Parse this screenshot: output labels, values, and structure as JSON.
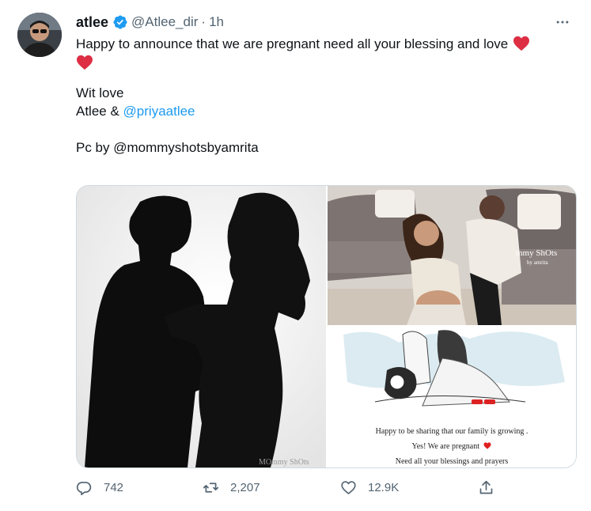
{
  "author": {
    "name": "atlee",
    "handle": "@Atlee_dir",
    "separator": "·",
    "time": "1h",
    "verified": true
  },
  "tweet": {
    "line1": "Happy to announce that we are pregnant need all your blessing and love",
    "line2": "Wit love",
    "line3_prefix": "Atlee & ",
    "line3_mention": "@priyaatlee",
    "line4": "Pc by @mommyshotsbyamrita"
  },
  "media": {
    "watermark_left": "MOmmy ShOts",
    "watermark_right": "mmy ShOts",
    "watermark_right_sub": "by amrita",
    "card_line1": "Happy to be sharing that our family is growing .",
    "card_line2": "Yes!  We are pregnant",
    "card_line3": "Need all your blessings and prayers"
  },
  "actions": {
    "replies": "742",
    "retweets": "2,207",
    "likes": "12.9K"
  },
  "colors": {
    "accent": "#1d9bf0",
    "heart": "#e0245e",
    "muted": "#536471",
    "border": "#cfd9de"
  },
  "icons": {
    "more": "more-icon",
    "reply": "reply-icon",
    "retweet": "retweet-icon",
    "like": "like-icon",
    "share": "share-icon",
    "verified": "verified-badge-icon",
    "heart": "red-heart-emoji"
  }
}
